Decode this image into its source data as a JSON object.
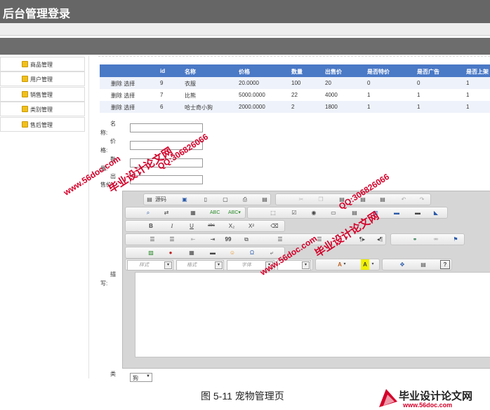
{
  "header": {
    "title": "后台管理登录"
  },
  "sidebar": {
    "items": [
      {
        "label": "商品管理"
      },
      {
        "label": "用户管理"
      },
      {
        "label": "销售管理"
      },
      {
        "label": "类别管理"
      },
      {
        "label": "售后管理"
      }
    ]
  },
  "table": {
    "columns": [
      "id",
      "名称",
      "价格",
      "数量",
      "出售价",
      "是否特价",
      "是否广告",
      "是否上架"
    ],
    "rows": [
      {
        "actions": "删除 选择",
        "id": "9",
        "name": "衣服",
        "price": "20.0000",
        "qty": "100",
        "sale": "20",
        "special": "0",
        "ad": "0",
        "onsale": "1"
      },
      {
        "actions": "删除 选择",
        "id": "7",
        "name": "比熊",
        "price": "5000.0000",
        "qty": "22",
        "sale": "4000",
        "special": "1",
        "ad": "1",
        "onsale": "1"
      },
      {
        "actions": "删除 选择",
        "id": "6",
        "name": "哈士奇小狗",
        "price": "2000.0000",
        "qty": "2",
        "sale": "1800",
        "special": "1",
        "ad": "1",
        "onsale": "1"
      }
    ]
  },
  "form": {
    "name_label_top": "名",
    "name_label_bottom": "称:",
    "price_label_top": "价",
    "price_label_bottom": "格:",
    "qty_label_top": "数",
    "qty_label_bottom": "量:",
    "sale_label_top": "出",
    "sale_label_bottom": "售价:",
    "desc_label_top": "描",
    "desc_label_bottom": "写:",
    "cat_label": "类",
    "cat_value": "狗"
  },
  "editor": {
    "source_label": "源码",
    "bold": "B",
    "italic": "I",
    "underline": "U",
    "strike": "abc",
    "sub": "X₂",
    "sup": "X²",
    "quote": "99",
    "style_combo": "样式",
    "format_combo": "格式",
    "font_combo": "字体",
    "size_combo": "大小",
    "text_color": "A",
    "bg_color": "A",
    "help": "?",
    "omega": "Ω"
  },
  "watermarks": {
    "site": "www.56doc.com",
    "qq": "QQ:306826066",
    "brand": "毕业设计论文网"
  },
  "caption": "图 5-11 宠物管理页",
  "footer_logo": {
    "brand": "毕业设计论文网",
    "url": "www.56doc.com"
  },
  "colors": {
    "header_bg": "#666666",
    "table_head": "#4a79c6",
    "watermark": "#d4002a"
  }
}
